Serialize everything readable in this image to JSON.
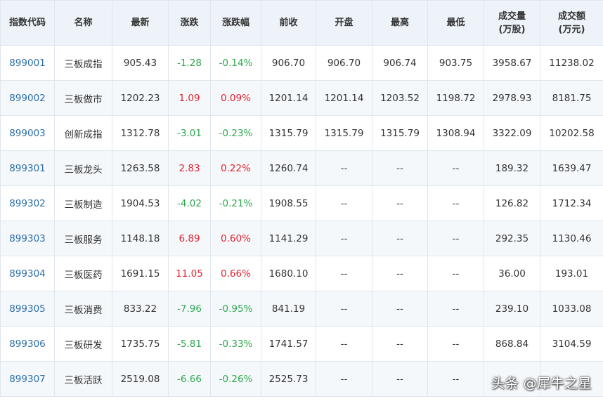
{
  "table": {
    "headers": [
      "指数代码",
      "名称",
      "最新",
      "涨跌",
      "涨跌幅",
      "前收",
      "开盘",
      "最高",
      "最低",
      "成交量\n(万股)",
      "成交额\n(万元)"
    ],
    "rows": [
      {
        "code": "899001",
        "name": "三板成指",
        "latest": "905.43",
        "change": "-1.28",
        "pct": "-0.14%",
        "prev": "906.70",
        "open": "906.70",
        "high": "906.74",
        "low": "903.75",
        "vol": "3958.67",
        "amt": "11238.02"
      },
      {
        "code": "899002",
        "name": "三板做市",
        "latest": "1202.23",
        "change": "1.09",
        "pct": "0.09%",
        "prev": "1201.14",
        "open": "1201.14",
        "high": "1203.52",
        "low": "1198.72",
        "vol": "2978.93",
        "amt": "8181.75"
      },
      {
        "code": "899003",
        "name": "创新成指",
        "latest": "1312.78",
        "change": "-3.01",
        "pct": "-0.23%",
        "prev": "1315.79",
        "open": "1315.79",
        "high": "1315.79",
        "low": "1308.94",
        "vol": "3322.09",
        "amt": "10202.58"
      },
      {
        "code": "899301",
        "name": "三板龙头",
        "latest": "1263.58",
        "change": "2.83",
        "pct": "0.22%",
        "prev": "1260.74",
        "open": "--",
        "high": "--",
        "low": "--",
        "vol": "189.32",
        "amt": "1639.47"
      },
      {
        "code": "899302",
        "name": "三板制造",
        "latest": "1904.53",
        "change": "-4.02",
        "pct": "-0.21%",
        "prev": "1908.55",
        "open": "--",
        "high": "--",
        "low": "--",
        "vol": "126.82",
        "amt": "1712.34"
      },
      {
        "code": "899303",
        "name": "三板服务",
        "latest": "1148.18",
        "change": "6.89",
        "pct": "0.60%",
        "prev": "1141.29",
        "open": "--",
        "high": "--",
        "low": "--",
        "vol": "292.35",
        "amt": "1130.46"
      },
      {
        "code": "899304",
        "name": "三板医药",
        "latest": "1691.15",
        "change": "11.05",
        "pct": "0.66%",
        "prev": "1680.10",
        "open": "--",
        "high": "--",
        "low": "--",
        "vol": "36.00",
        "amt": "193.01"
      },
      {
        "code": "899305",
        "name": "三板消费",
        "latest": "833.22",
        "change": "-7.96",
        "pct": "-0.95%",
        "prev": "841.19",
        "open": "--",
        "high": "--",
        "low": "--",
        "vol": "239.10",
        "amt": "1033.08"
      },
      {
        "code": "899306",
        "name": "三板研发",
        "latest": "1735.75",
        "change": "-5.81",
        "pct": "-0.33%",
        "prev": "1741.57",
        "open": "--",
        "high": "--",
        "low": "--",
        "vol": "868.84",
        "amt": "3104.59"
      },
      {
        "code": "899307",
        "name": "三板活跃",
        "latest": "2519.08",
        "change": "-6.66",
        "pct": "-0.26%",
        "prev": "2525.73",
        "open": "--",
        "high": "--",
        "low": "--",
        "vol": "--",
        "amt": "--"
      }
    ]
  },
  "watermark": "头条 @犀牛之星",
  "colors": {
    "header_bg": "#eef3f9",
    "stripe_bg": "#f5f8fb",
    "border": "#dfe6ee",
    "code_link": "#2c6ea8",
    "up": "#e0242e",
    "down": "#2ea84f",
    "text": "#333333"
  }
}
